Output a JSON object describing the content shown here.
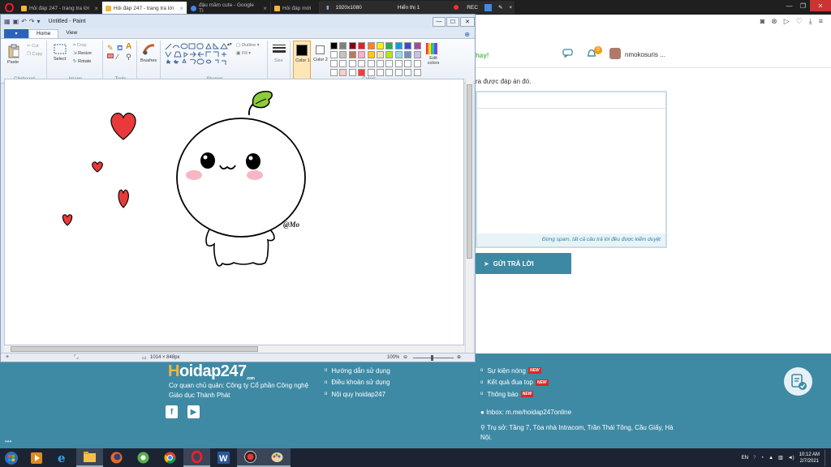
{
  "browser": {
    "tabs": [
      {
        "title": "Hỏi đáp 247 - trang tra lời",
        "active": false
      },
      {
        "title": "Hỏi đáp 247 - trang tra lời",
        "active": true
      },
      {
        "title": "đậu mầm cute - Google Tì",
        "active": false
      },
      {
        "title": "Hỏi đáp mới",
        "active": false
      }
    ],
    "recorder": {
      "resolution": "1920x1080",
      "mode": "Hiển thị 1",
      "rec_label": "REC"
    }
  },
  "web": {
    "header_hint": "hay!",
    "notification_count": "0",
    "username": "nmokosuris ...",
    "answer_note": "ra được đáp án đó.",
    "answer_footer": "Đừng spam, tất cả câu trả lời đều được kiểm duyệt",
    "submit_label": "GỬI TRẢ LỜI",
    "footer": {
      "logo": "Hoidap247",
      "logo_h": "H",
      "logo_rest": "oidap247",
      "logo_com": ".com",
      "org": "Cơ quan chủ quản: Công ty Cổ phần Công nghệ Giáo dục Thành Phát",
      "links": [
        "Hướng dẫn sử dụng",
        "Điều khoản sử dụng",
        "Nội quy hoidap247"
      ],
      "events": [
        {
          "label": "Sự kiện nóng",
          "badge": "NEW"
        },
        {
          "label": "Kết quả đua top",
          "badge": "NEW"
        },
        {
          "label": "Thông báo",
          "badge": "NEW"
        }
      ],
      "inbox": "Inbox: m.me/hoidap247online",
      "address": "Trụ sở: Tầng 7, Tòa nhà Intracom, Trần Thái Tông, Cầu Giấy, Hà Nội."
    }
  },
  "paint": {
    "title": "Untitled - Paint",
    "file_tab": "▾",
    "tabs": [
      "Home",
      "View"
    ],
    "ribbon": {
      "clipboard": {
        "label": "Clipboard",
        "paste": "Paste",
        "cut": "Cut",
        "copy": "Copy"
      },
      "image": {
        "label": "Image",
        "select": "Select",
        "crop": "Crop",
        "resize": "Resize",
        "rotate": "Rotate"
      },
      "tools": {
        "label": "Tools"
      },
      "brushes": "Brushes",
      "shapes": {
        "label": "Shapes",
        "outline": "Outline",
        "fill": "Fill"
      },
      "size": "Size",
      "color1": "Color 1",
      "color2": "Color 2",
      "colors_label": "Colors",
      "edit_colors": "Edit colors"
    },
    "palette": [
      "#000000",
      "#7f7f7f",
      "#880015",
      "#ed1c24",
      "#ff7f27",
      "#fff200",
      "#22b14c",
      "#00a2e8",
      "#3f48cc",
      "#a349a4",
      "#ffffff",
      "#c3c3c3",
      "#b97a57",
      "#ffaec9",
      "#ffc90e",
      "#efe4b0",
      "#b5e61d",
      "#99d9ea",
      "#7092be",
      "#c8bfe7",
      "#ffffff",
      "#ffffff",
      "#ffffff",
      "#ffffff",
      "#ffffff",
      "#ffffff",
      "#ffffff",
      "#ffffff",
      "#ffffff",
      "#ffffff",
      "#ffffff",
      "#ffcccc",
      "#ffffff",
      "#ff3b3b",
      "#ffffff",
      "#ffffff",
      "#ffffff",
      "#ffffff",
      "#ffffff",
      "#ffffff"
    ],
    "drawing_signature": "@Mo",
    "status": {
      "dimensions": "1014 × 848px",
      "zoom": "100%"
    }
  },
  "taskbar": {
    "clock_time": "10:12 AM",
    "clock_date": "2/7/2021"
  }
}
